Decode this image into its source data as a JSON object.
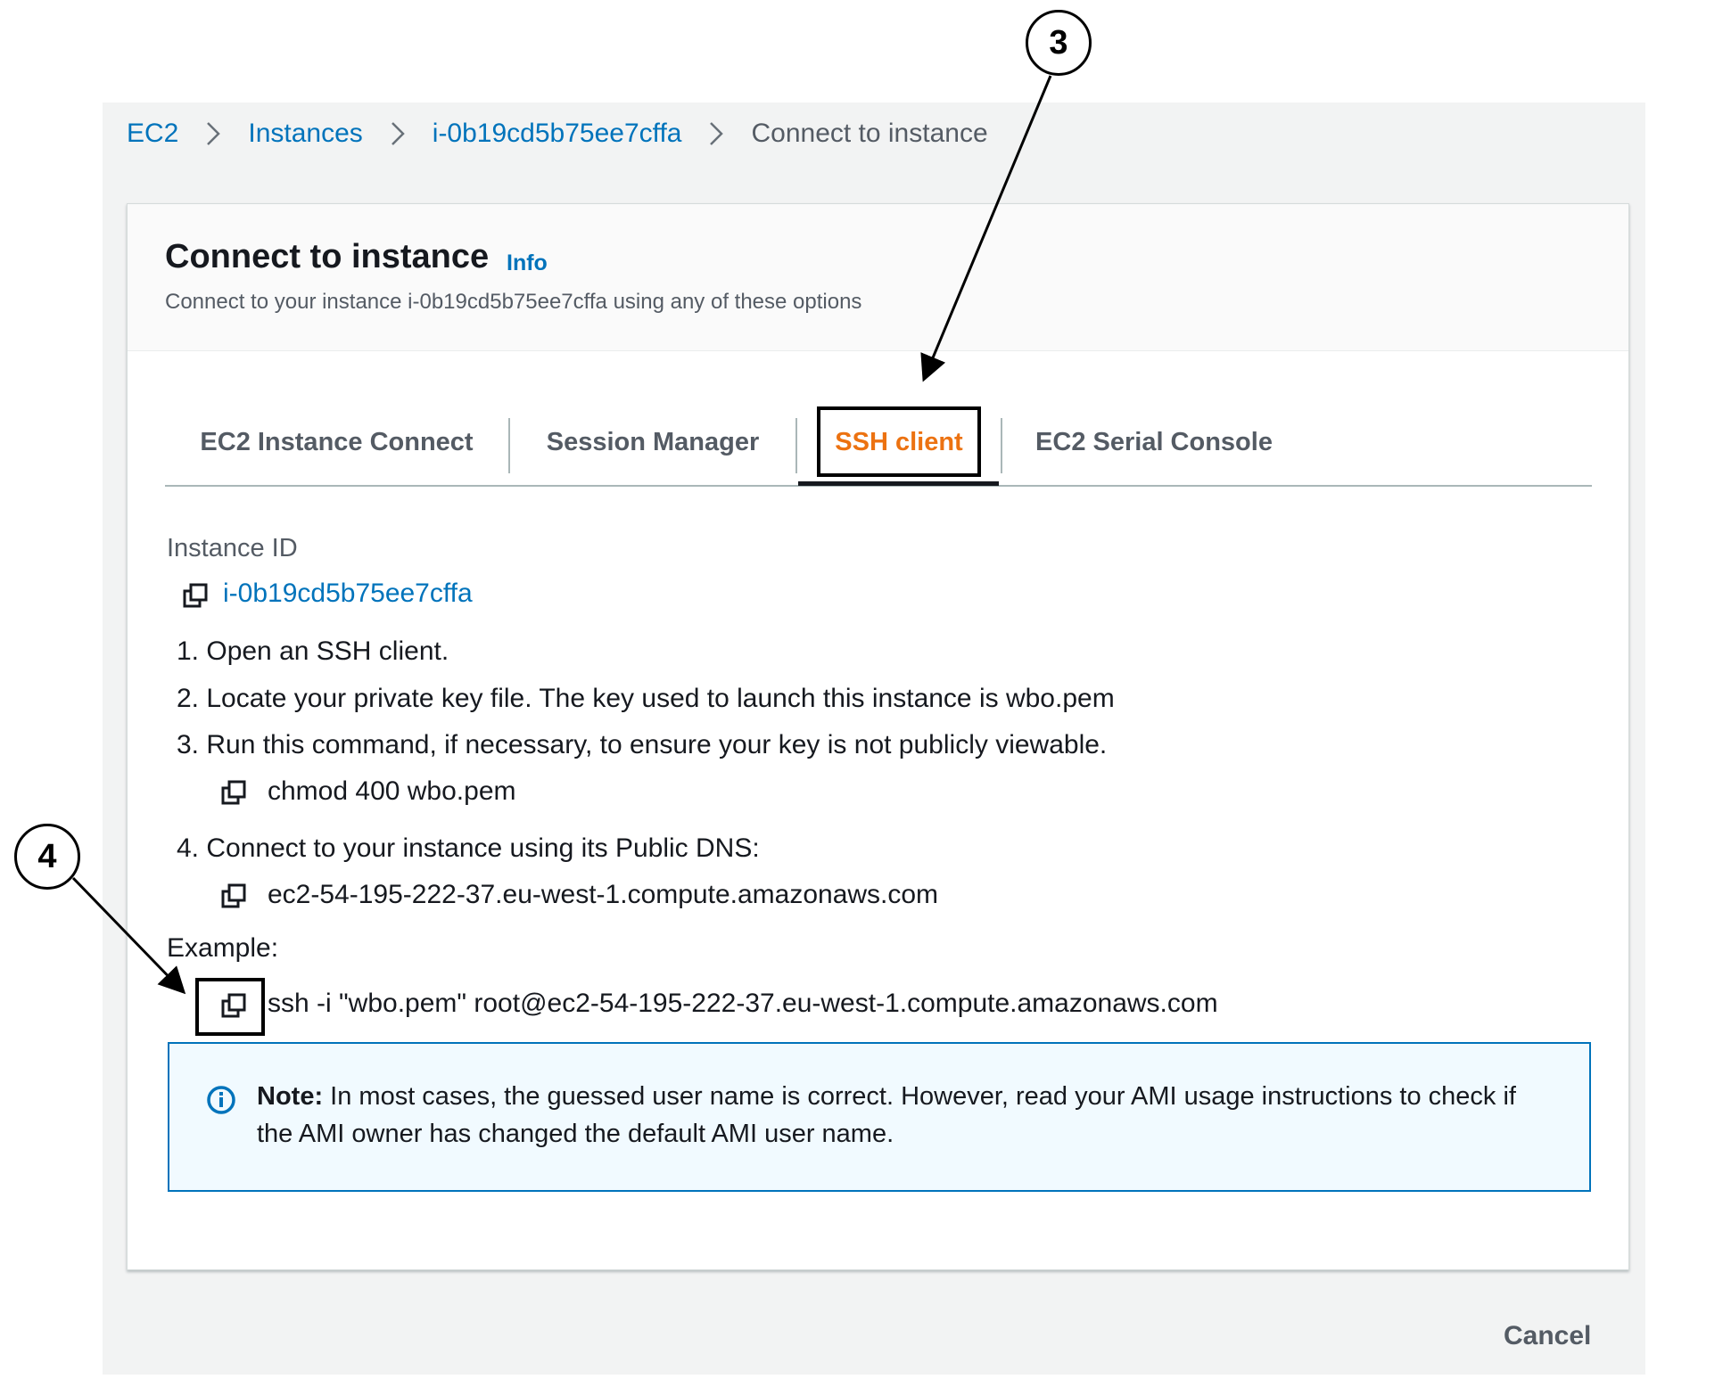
{
  "breadcrumb": {
    "items": [
      "EC2",
      "Instances",
      "i-0b19cd5b75ee7cffa"
    ],
    "current": "Connect to instance"
  },
  "panel": {
    "title": "Connect to instance",
    "info_label": "Info",
    "description": "Connect to your instance i-0b19cd5b75ee7cffa using any of these options"
  },
  "tabs": [
    {
      "label": "EC2 Instance Connect",
      "active": false
    },
    {
      "label": "Session Manager",
      "active": false
    },
    {
      "label": "SSH client",
      "active": true
    },
    {
      "label": "EC2 Serial Console",
      "active": false
    }
  ],
  "content": {
    "instance_id_label": "Instance ID",
    "instance_id": "i-0b19cd5b75ee7cffa",
    "steps": [
      "1. Open an SSH client.",
      "2. Locate your private key file. The key used to launch this instance is wbo.pem",
      "3. Run this command, if necessary, to ensure your key is not publicly viewable.",
      "4. Connect to your instance using its Public DNS:"
    ],
    "chmod_command": "chmod 400 wbo.pem",
    "public_dns": "ec2-54-195-222-37.eu-west-1.compute.amazonaws.com",
    "example_label": "Example:",
    "example_command": "ssh -i \"wbo.pem\" root@ec2-54-195-222-37.eu-west-1.compute.amazonaws.com"
  },
  "note": {
    "label": "Note:",
    "text": " In most cases, the guessed user name is correct. However, read your AMI usage instructions to check if the AMI owner has changed the default AMI user name."
  },
  "footer": {
    "cancel_label": "Cancel"
  },
  "callouts": {
    "tab_marker": "3",
    "copy_marker": "4"
  },
  "colors": {
    "link": "#0073bb",
    "active_tab": "#ec7211",
    "alert_border": "#0073bb",
    "alert_bg": "#f1faff"
  },
  "icons": [
    "chevron-right-icon",
    "copy-icon",
    "info-circle-icon"
  ]
}
